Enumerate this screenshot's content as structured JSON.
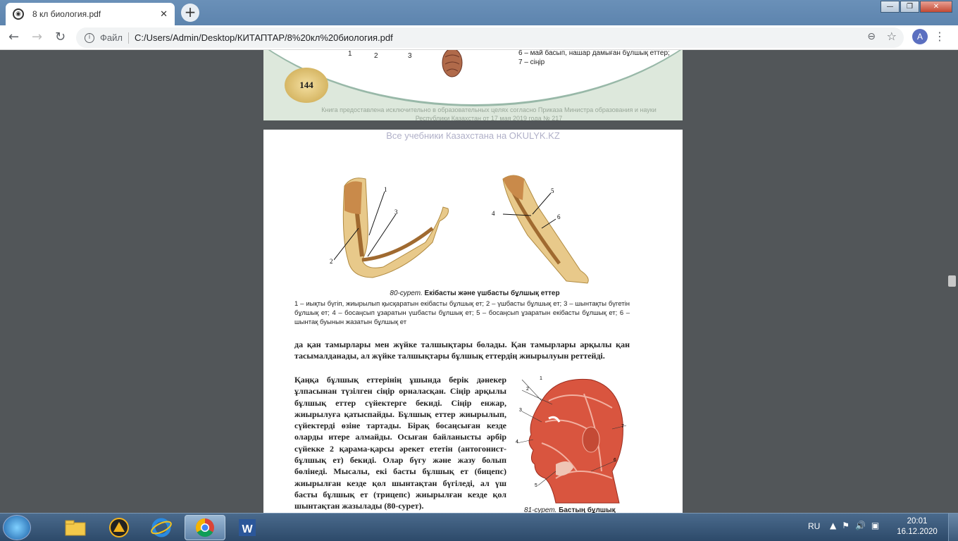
{
  "browser": {
    "tab_title": "8 кл биология.pdf",
    "tab_close": "✕",
    "new_tab": "+",
    "omnibox_label": "Файл",
    "url": "C:/Users/Admin/Desktop/КИТАПТАР/8%20кл%20биология.pdf",
    "avatar_letter": "A",
    "menu": "⋮",
    "win_minimize": "—",
    "win_maximize": "❐",
    "win_close": "✕"
  },
  "page_prev": {
    "fig_nums": [
      "1",
      "2",
      "3"
    ],
    "caption": "6 – май басып, нашар дамыған бұлшық еттер; 7 – сіңір",
    "page_number": "144",
    "footer": "Книга предоставлена исключительно в образовательных целях согласно Приказа Министра образования и науки Республики Казахстан от 17 мая 2019 года № 217"
  },
  "page_current": {
    "watermark": "Все учебники Казахстана на OKULYK.KZ",
    "fig80_labels": [
      "1",
      "2",
      "3",
      "4",
      "5",
      "6"
    ],
    "fig80_caption_num": "80-сурет.",
    "fig80_caption_title": "Екібасты және үшбасты бұлшық еттер",
    "fig80_legend": "1 – иықты бүгіп, жиырылып қысқаратын екібасты бұлшық ет; 2 – үшбасты бұлшық ет; 3 – шынтақты бүгетін бұлшық ет; 4 – босаңсып ұзаратын үшбасты бұлшық ет; 5 – босаңсып ұзаратын екібасты бұлшық ет; 6 – шынтақ буынын жазатын бұлшық ет",
    "para1": "да қан тамырлары мен жүйке талшықтары болады. Қан тамырлары арқылы қан тасымалданады, ал жүйке талшықтары бұлшық еттердің жиырылуын реттейді.",
    "para2": "Қаңқа бұлшық еттерінің ұшында берік дәнекер ұлпасынан түзілген сіңір орналасқан. Сіңір арқылы бұлшық еттер сүйектерге бекиді. Сіңір енжар, жиырылуға қатыспайды. Бұлшық еттер жиырылып, сүйектерді өзіне тартады. Бірақ босаңсыған кезде оларды итере алмайды. Осыған байланысты әрбір сүйекке 2 қарама-қарсы әрекет ететін (антогонист-бұлшық ет) бекиді. Олар бүгу және жазу болып бөлінеді. Мысалы, екі басты бұлшық ет (бицепс) жиырылған кезде қол шынтақтан бүгіледі, ал үш басты бұлшық ет (трицепс) жиырылған кезде қол шынтақтан жазылады (80-сурет).",
    "fig81_labels": [
      "1",
      "2",
      "3",
      "4",
      "5",
      "6",
      "7"
    ],
    "fig81_caption_num": "81-сурет.",
    "fig81_caption_title": "Бастың бұлшық"
  },
  "taskbar": {
    "language": "RU",
    "time": "20:01",
    "date": "16.12.2020",
    "apps": [
      "explorer",
      "media-player",
      "internet-explorer",
      "chrome",
      "word"
    ]
  }
}
